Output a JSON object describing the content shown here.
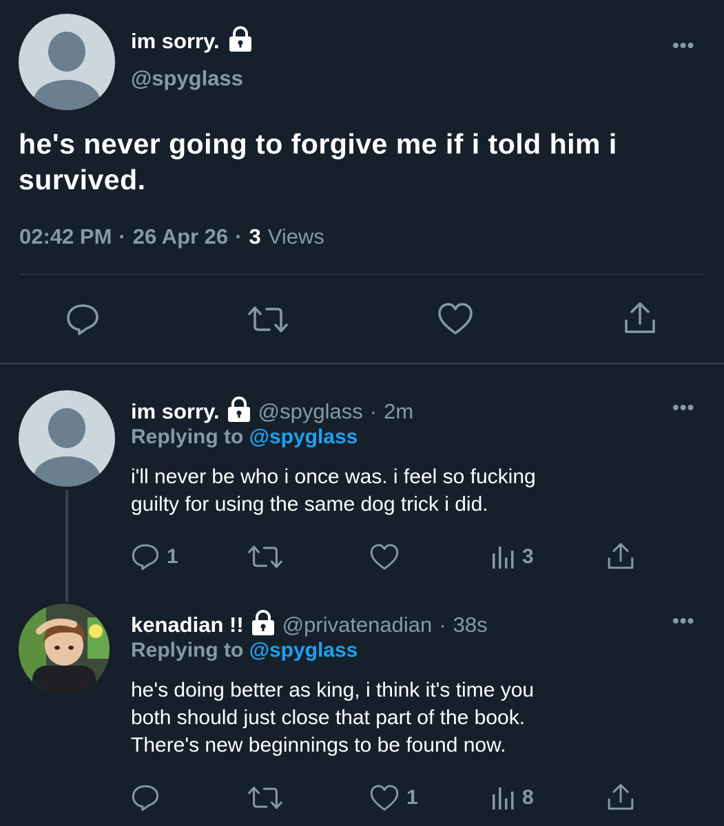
{
  "main_tweet": {
    "display_name": "im sorry.",
    "handle": "@spyglass",
    "text": "he's never going to forgive me if i told him i survived.",
    "time": "02:42 PM",
    "sep1": "·",
    "date": "26 Apr 26",
    "sep2": "·",
    "views_count": "3",
    "views_label": "Views",
    "more": "•••"
  },
  "replies": [
    {
      "display_name": "im sorry.",
      "handle": "@spyglass",
      "sep": "·",
      "time_ago": "2m",
      "replying_prefix": "Replying to",
      "replying_to": "@spyglass",
      "text_line1": "i'll never be who i once was. i feel so fucking",
      "text_line2": "guilty for using the same dog trick i did.",
      "reply_count": "1",
      "retweet_count": "",
      "like_count": "",
      "view_count": "3",
      "more": "•••"
    },
    {
      "display_name": "kenadian !!",
      "handle": "@privatenadian",
      "sep": "·",
      "time_ago": "38s",
      "replying_prefix": "Replying to",
      "replying_to": "@spyglass",
      "text_line1": "he's doing better as king, i think it's time you",
      "text_line2": "both should just close that part of the book.",
      "text_line3": "There's new beginnings to be found now.",
      "reply_count": "",
      "retweet_count": "",
      "like_count": "1",
      "view_count": "8",
      "more": "•••"
    }
  ],
  "icons": {
    "reply": "speech-bubble-icon",
    "retweet": "retweet-icon",
    "like": "heart-icon",
    "share": "share-icon",
    "views": "bar-chart-icon",
    "lock": "lock-icon",
    "more": "more-icon"
  },
  "colors": {
    "background": "#15202b",
    "muted": "#8899a6",
    "link": "#1da1f2",
    "divider": "#38444d"
  }
}
